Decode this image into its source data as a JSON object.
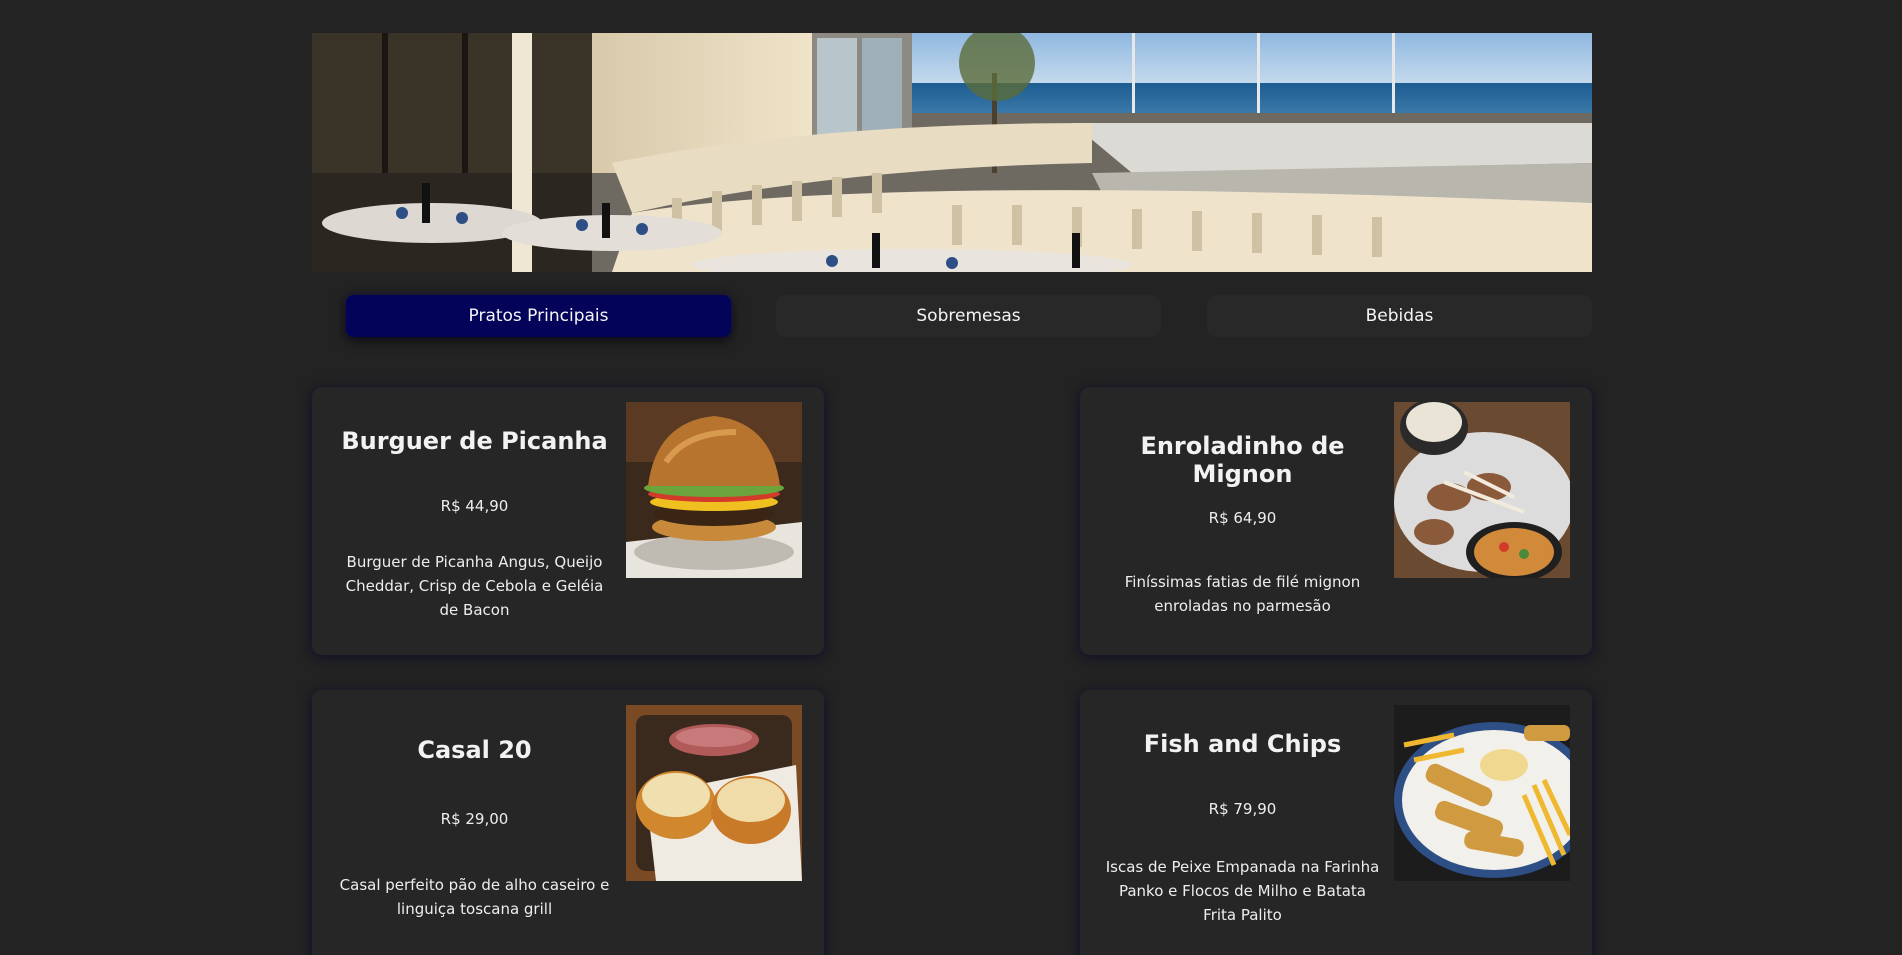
{
  "tabs": [
    {
      "label": "Pratos Principais",
      "active": true
    },
    {
      "label": "Sobremesas",
      "active": false
    },
    {
      "label": "Bebidas",
      "active": false
    }
  ],
  "menu_items": [
    {
      "name": "Burguer de Picanha",
      "price": "R$ 44,90",
      "description": "Burguer de Picanha Angus, Queijo Cheddar, Crisp de Cebola e Geléia de Bacon",
      "image": "burger-photo"
    },
    {
      "name": "Enroladinho de Mignon",
      "price": "R$ 64,90",
      "description": "Finíssimas fatias de filé mignon enroladas no parmesão",
      "image": "mignon-rolls-photo"
    },
    {
      "name": "Casal 20",
      "price": "R$ 29,00",
      "description": "Casal perfeito pão de alho caseiro e linguiça toscana grill",
      "image": "garlic-bread-sausage-photo"
    },
    {
      "name": "Fish and Chips",
      "price": "R$ 79,90",
      "description": "Iscas de Peixe Empanada na Farinha Panko e Flocos de Milho e Batata Frita Palito",
      "image": "fish-and-chips-photo"
    }
  ],
  "colors": {
    "background": "#232323",
    "card": "#262626",
    "active_tab": "#03035a",
    "inactive_tab": "#282828"
  }
}
